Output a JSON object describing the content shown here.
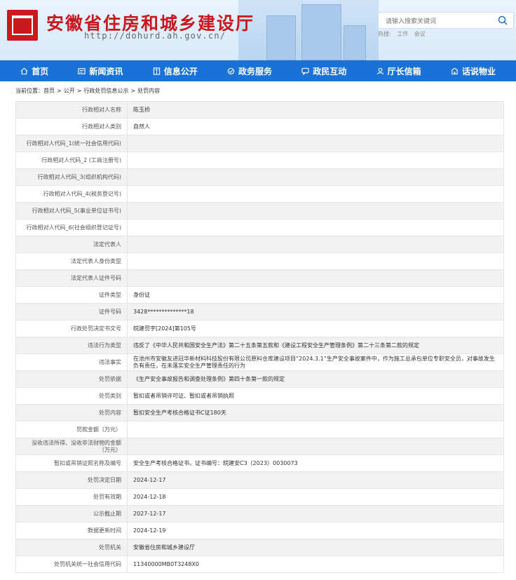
{
  "site": {
    "title": "安徽省住房和城乡建设厅",
    "url": "http://dohurd.ah.gov.cn/",
    "search_placeholder": "请输入搜索关键词",
    "hot_label": "热搜:",
    "hot_words": [
      "工作",
      "会议"
    ]
  },
  "nav": [
    {
      "label": "首页",
      "icon": "home-icon"
    },
    {
      "label": "新闻资讯",
      "icon": "news-icon"
    },
    {
      "label": "信息公开",
      "icon": "doc-icon"
    },
    {
      "label": "政务服务",
      "icon": "service-icon"
    },
    {
      "label": "政民互动",
      "icon": "chat-icon"
    },
    {
      "label": "厅长信箱",
      "icon": "mail-icon"
    },
    {
      "label": "话说物业",
      "icon": "property-icon"
    }
  ],
  "breadcrumb": {
    "prefix": "当前位置：",
    "items": [
      "首页",
      ">",
      "公开",
      ">",
      "行政处罚信息公示",
      ">",
      "处罚内容"
    ]
  },
  "rows": [
    {
      "k": "行政相对人名称",
      "v": "陈玉桥"
    },
    {
      "k": "行政相对人类别",
      "v": "自然人"
    },
    {
      "k": "行政相对人代码_1(统一社会信用代码)",
      "v": ""
    },
    {
      "k": "行政相对人代码_2 (工商注册号)",
      "v": ""
    },
    {
      "k": "行政相对人代码_3(组织机构代码)",
      "v": ""
    },
    {
      "k": "行政相对人代码_4(税务登记号)",
      "v": ""
    },
    {
      "k": "行政相对人代码_5(事业单位证书号)",
      "v": ""
    },
    {
      "k": "行政相对人代码_6(社会组织登记证号)",
      "v": ""
    },
    {
      "k": "法定代表人",
      "v": ""
    },
    {
      "k": "法定代表人身份类型",
      "v": ""
    },
    {
      "k": "法定代表人证件号码",
      "v": ""
    },
    {
      "k": "证件类型",
      "v": "身份证"
    },
    {
      "k": "证件号码",
      "v": "3428**************18"
    },
    {
      "k": "行政处罚决定书文号",
      "v": "皖建罚字[2024]第105号"
    },
    {
      "k": "违法行为类型",
      "v": "违反了《中华人民共和国安全生产法》第二十五条第五款和《建设工程安全生产管理条例》第二十三条第二款的规定"
    },
    {
      "k": "违法事实",
      "v": "在池州市安徽友进冠华新材料科技股份有限公司原料仓库建设项目“2024.3.1”生产安全事故案件中，作为施工总承包单位专职安全员，对事故发生负有责任，在未落实安全生产管理责任的行为"
    },
    {
      "k": "处罚依据",
      "v": "《生产安全事故报告和调查处理条例》第四十条第一款的规定"
    },
    {
      "k": "处罚类别",
      "v": "暂扣或者吊销许可证、暂扣或者吊销执照"
    },
    {
      "k": "处罚内容",
      "v": "暂扣安全生产考核合格证书C证180天"
    },
    {
      "k": "罚款金额（万元）",
      "v": ""
    },
    {
      "k": "没收违法所得、没收非法财物的金额（万元）",
      "v": ""
    },
    {
      "k": "暂扣或吊销证照名称及编号",
      "v": "安全生产考核合格证书，证书编号：皖建安C3（2023）0030073"
    },
    {
      "k": "处罚决定日期",
      "v": "2024-12-17"
    },
    {
      "k": "处罚有效期",
      "v": "2024-12-18"
    },
    {
      "k": "公示截止期",
      "v": "2027-12-17"
    },
    {
      "k": "数据更新时间",
      "v": "2024-12-19"
    },
    {
      "k": "处罚机关",
      "v": "安徽省住房和城乡建设厅"
    },
    {
      "k": "处罚机关统一社会信用代码",
      "v": "11340000MB0T3248X0"
    }
  ]
}
